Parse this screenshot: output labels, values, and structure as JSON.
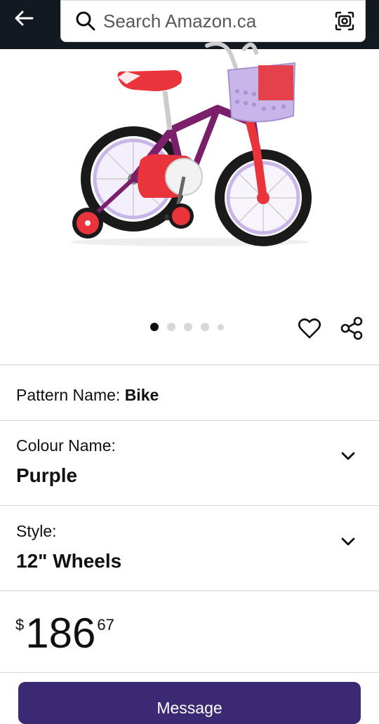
{
  "header": {
    "search_placeholder": "Search Amazon.ca"
  },
  "image_carousel": {
    "total_dots": 5,
    "active_index": 0
  },
  "variations": {
    "pattern_label": "Pattern Name:",
    "pattern_value": "Bike",
    "colour_label": "Colour Name:",
    "colour_value": "Purple",
    "style_label": "Style:",
    "style_value": "12\" Wheels"
  },
  "price": {
    "symbol": "$",
    "whole": "186",
    "fraction": "67"
  },
  "cta": {
    "message_label": "Message"
  },
  "colors": {
    "header_bg": "#131921",
    "button_bg": "#3b2a73",
    "bike_frame": "#7b1f6b",
    "bike_accent": "#e8343a",
    "basket": "#c9b6e8"
  }
}
